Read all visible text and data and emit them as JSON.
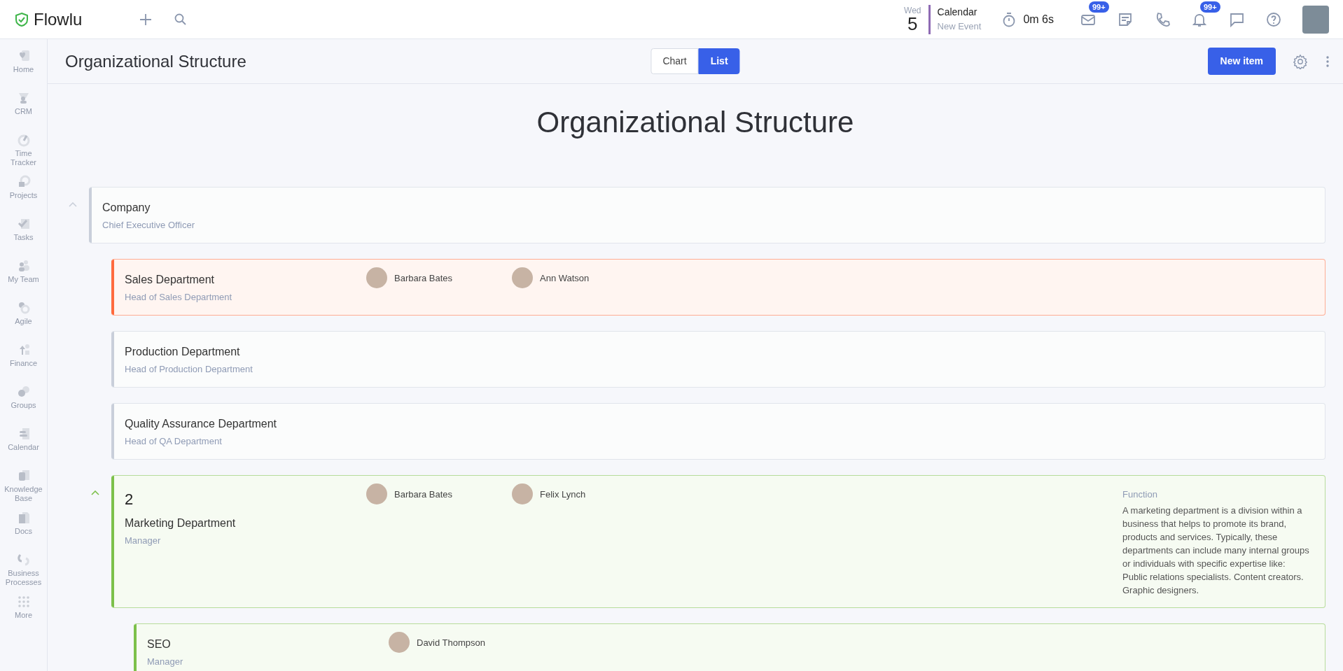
{
  "app": {
    "logo": "Flowlu"
  },
  "topbar": {
    "date": {
      "weekday": "Wed",
      "day": "5"
    },
    "calendar": {
      "title": "Calendar",
      "subtitle": "New Event"
    },
    "timer": "0m 6s",
    "icons": [
      {
        "kind": "mail",
        "badge": "99+"
      },
      {
        "kind": "notes"
      },
      {
        "kind": "phone"
      },
      {
        "kind": "bell",
        "badge": "99+"
      },
      {
        "kind": "chat"
      },
      {
        "kind": "help"
      }
    ]
  },
  "sidebar": {
    "items": [
      {
        "label": "Home"
      },
      {
        "label": "CRM"
      },
      {
        "label": "Time Tracker"
      },
      {
        "label": "Projects"
      },
      {
        "label": "Tasks"
      },
      {
        "label": "My Team"
      },
      {
        "label": "Agile"
      },
      {
        "label": "Finance"
      },
      {
        "label": "Groups"
      },
      {
        "label": "Calendar"
      },
      {
        "label": "Knowledge Base"
      },
      {
        "label": "Docs"
      },
      {
        "label": "Business Processes"
      },
      {
        "label": "More"
      }
    ]
  },
  "page_header": {
    "title": "Organizational Structure",
    "views": [
      {
        "label": "Chart",
        "selected": false
      },
      {
        "label": "List",
        "selected": true
      }
    ],
    "primary_button": "New item"
  },
  "heading": "Organizational Structure",
  "tree": [
    {
      "name": "Company",
      "position": "Chief Executive Officer",
      "color": "#c9cfda",
      "expanded": true,
      "children": [
        {
          "name": "Sales Department",
          "position": "Head of Sales Department",
          "color": "#ff6a3d",
          "members": [
            {
              "name": "Barbara Bates"
            },
            {
              "name": "Ann Watson"
            }
          ]
        },
        {
          "name": "Production Department",
          "position": "Head of Production Department",
          "color": "#c9cfda"
        },
        {
          "name": "Quality Assurance Department",
          "position": "Head of QA Department",
          "color": "#c9cfda"
        },
        {
          "name": "Marketing Department",
          "position": "Manager",
          "color": "#7cc04a",
          "expanded": true,
          "count": "2",
          "members": [
            {
              "name": "Barbara Bates"
            },
            {
              "name": "Felix Lynch"
            }
          ],
          "function": {
            "label": "Function",
            "text": "A marketing department is a division within a business that helps to promote its brand, products and services. Typically, these departments can include many internal groups or individuals with specific expertise like: Public relations specialists. Content creators. Graphic designers."
          },
          "children": [
            {
              "name": "SEO",
              "position": "Manager",
              "color": "#7cc04a",
              "members": [
                {
                  "name": "David Thompson"
                }
              ]
            }
          ]
        }
      ]
    }
  ]
}
